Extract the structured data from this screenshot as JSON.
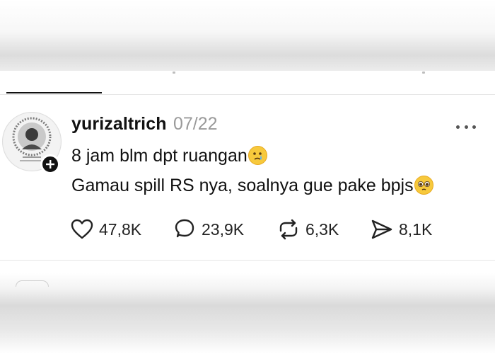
{
  "post": {
    "username": "yurizaltrich",
    "date": "07/22",
    "lines": [
      "8 jam blm dpt ruangan",
      "Gamau spill RS nya, soalnya gue pake bpjs"
    ],
    "emojis": [
      "crying-face-emoji",
      "pleading-face-emoji"
    ]
  },
  "actions": {
    "likes": "47,8K",
    "replies": "23,9K",
    "reposts": "6,3K",
    "shares": "8,1K"
  },
  "icons": [
    "heart-icon",
    "reply-icon",
    "repost-icon",
    "share-icon",
    "more-icon",
    "follow-plus-icon"
  ],
  "colors": {
    "text": "#111111",
    "muted": "#9a9a9a",
    "divider": "#e6e6e6",
    "emoji": "#f7c93c"
  }
}
